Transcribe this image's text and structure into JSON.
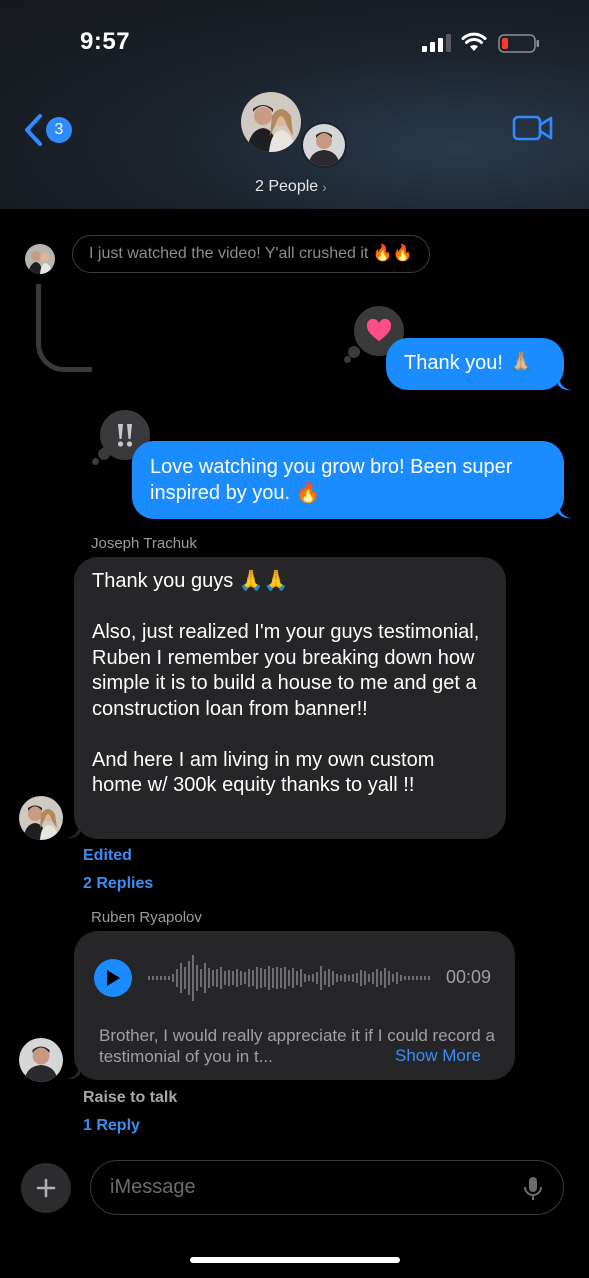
{
  "status_bar": {
    "time": "9:57"
  },
  "header": {
    "back_badge": "3",
    "group_label": "2 People",
    "icons": {
      "back": "chevron-left-icon",
      "video": "video-camera-icon",
      "chevron": "chevron-right-icon"
    }
  },
  "messages": {
    "reply_preview": "I just watched the video! Y'all crushed it 🔥🔥",
    "thank_you": "Thank you! 🙏🏼",
    "thank_you_tapback": "heart-icon",
    "love_watching": "Love watching you grow bro! Been super inspired by you. 🔥",
    "love_watching_tapback": "double-exclamation-icon",
    "joseph": {
      "sender": "Joseph Trachuk",
      "line1": "Thank you guys 🙏🙏",
      "line2": "Also, just realized I'm your guys testimonial, Ruben I remember you breaking down how simple it is to build a house to me and get a construction loan from banner!!",
      "line3": "And here I am living in my own custom home w/ 300k equity thanks to yall !!",
      "edited": "Edited",
      "replies": "2 Replies"
    },
    "ruben": {
      "sender": "Ruben Ryapolov",
      "duration": "00:09",
      "transcript": "Brother, I would really appreciate it if I could record a testimonial of you in t...",
      "show_more": "Show More",
      "raise_to_talk": "Raise to talk",
      "reply": "1 Reply"
    }
  },
  "composer": {
    "placeholder": "iMessage"
  },
  "colors": {
    "blue_bubble": "#1a8cff",
    "gray_bubble": "#262628",
    "link": "#3b8ef3",
    "heart": "#ff4f8b"
  }
}
